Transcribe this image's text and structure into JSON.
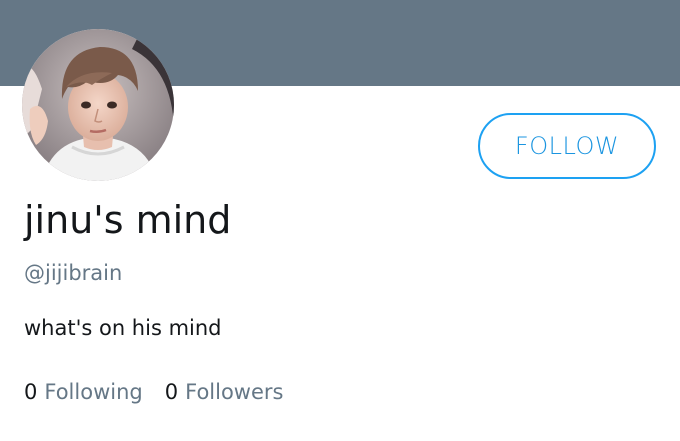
{
  "profile": {
    "display_name": "jinu's mind",
    "handle": "@jijibrain",
    "bio": "what's on his mind",
    "avatar_icon": "profile-photo"
  },
  "actions": {
    "follow_label": "FOLLOW"
  },
  "stats": {
    "following_count": "0",
    "following_label": "Following",
    "followers_count": "0",
    "followers_label": "Followers"
  },
  "colors": {
    "banner": "#657786",
    "accent": "#1da1f2",
    "secondary_text": "#657786"
  }
}
